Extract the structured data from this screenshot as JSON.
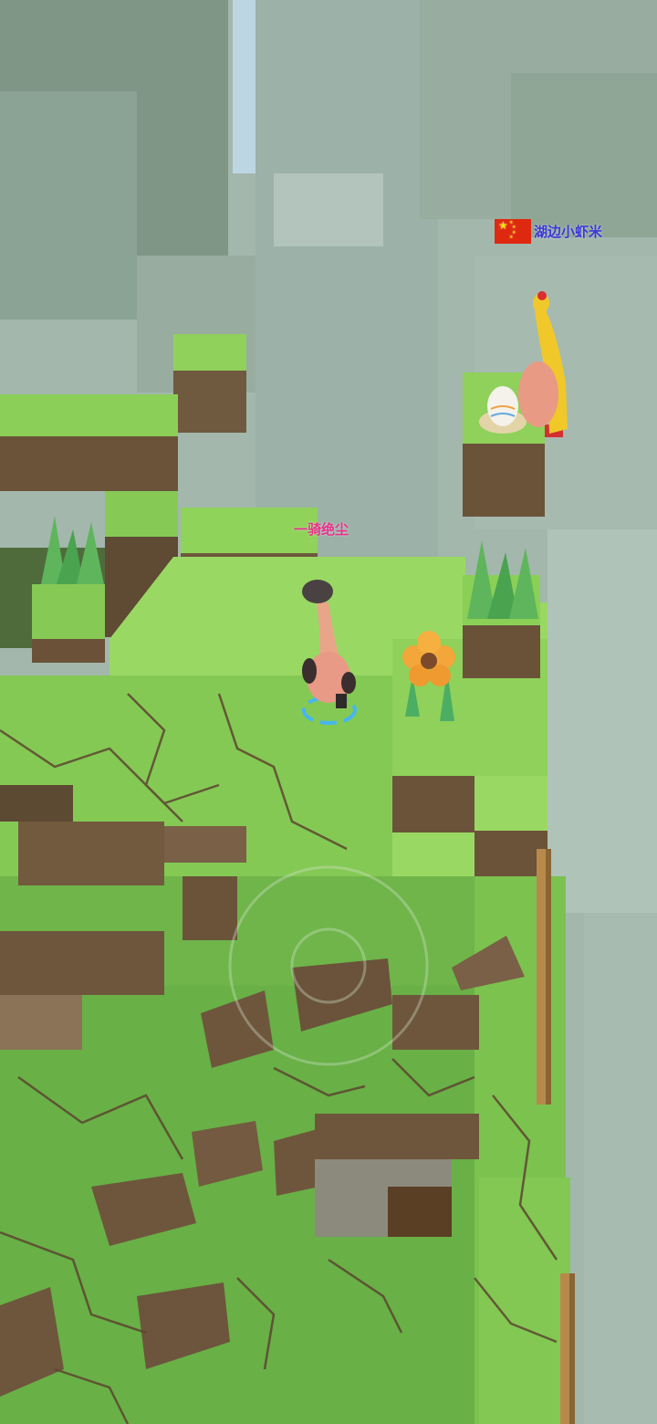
{
  "players": {
    "self": {
      "name": "一骑绝尘",
      "color": "#e8308a"
    },
    "opponent": {
      "name": "湖边小虾米",
      "color": "#3b36d6",
      "country_flag": "china-flag-icon"
    }
  },
  "hud": {
    "joystick": {
      "icon": "virtual-joystick-icon"
    },
    "move_indicator": {
      "icon": "selection-ring-icon",
      "color": "#4ab8f0"
    }
  },
  "objects": {
    "egg": {
      "icon": "easter-egg-icon"
    },
    "flower": {
      "icon": "flower-icon"
    },
    "fence": {
      "icon": "wooden-fence-icon"
    }
  },
  "palette": {
    "grass": "#8ed45a",
    "grass_dark": "#63a640",
    "dirt": "#7a5a3e",
    "fog": "#a9bcb2"
  }
}
